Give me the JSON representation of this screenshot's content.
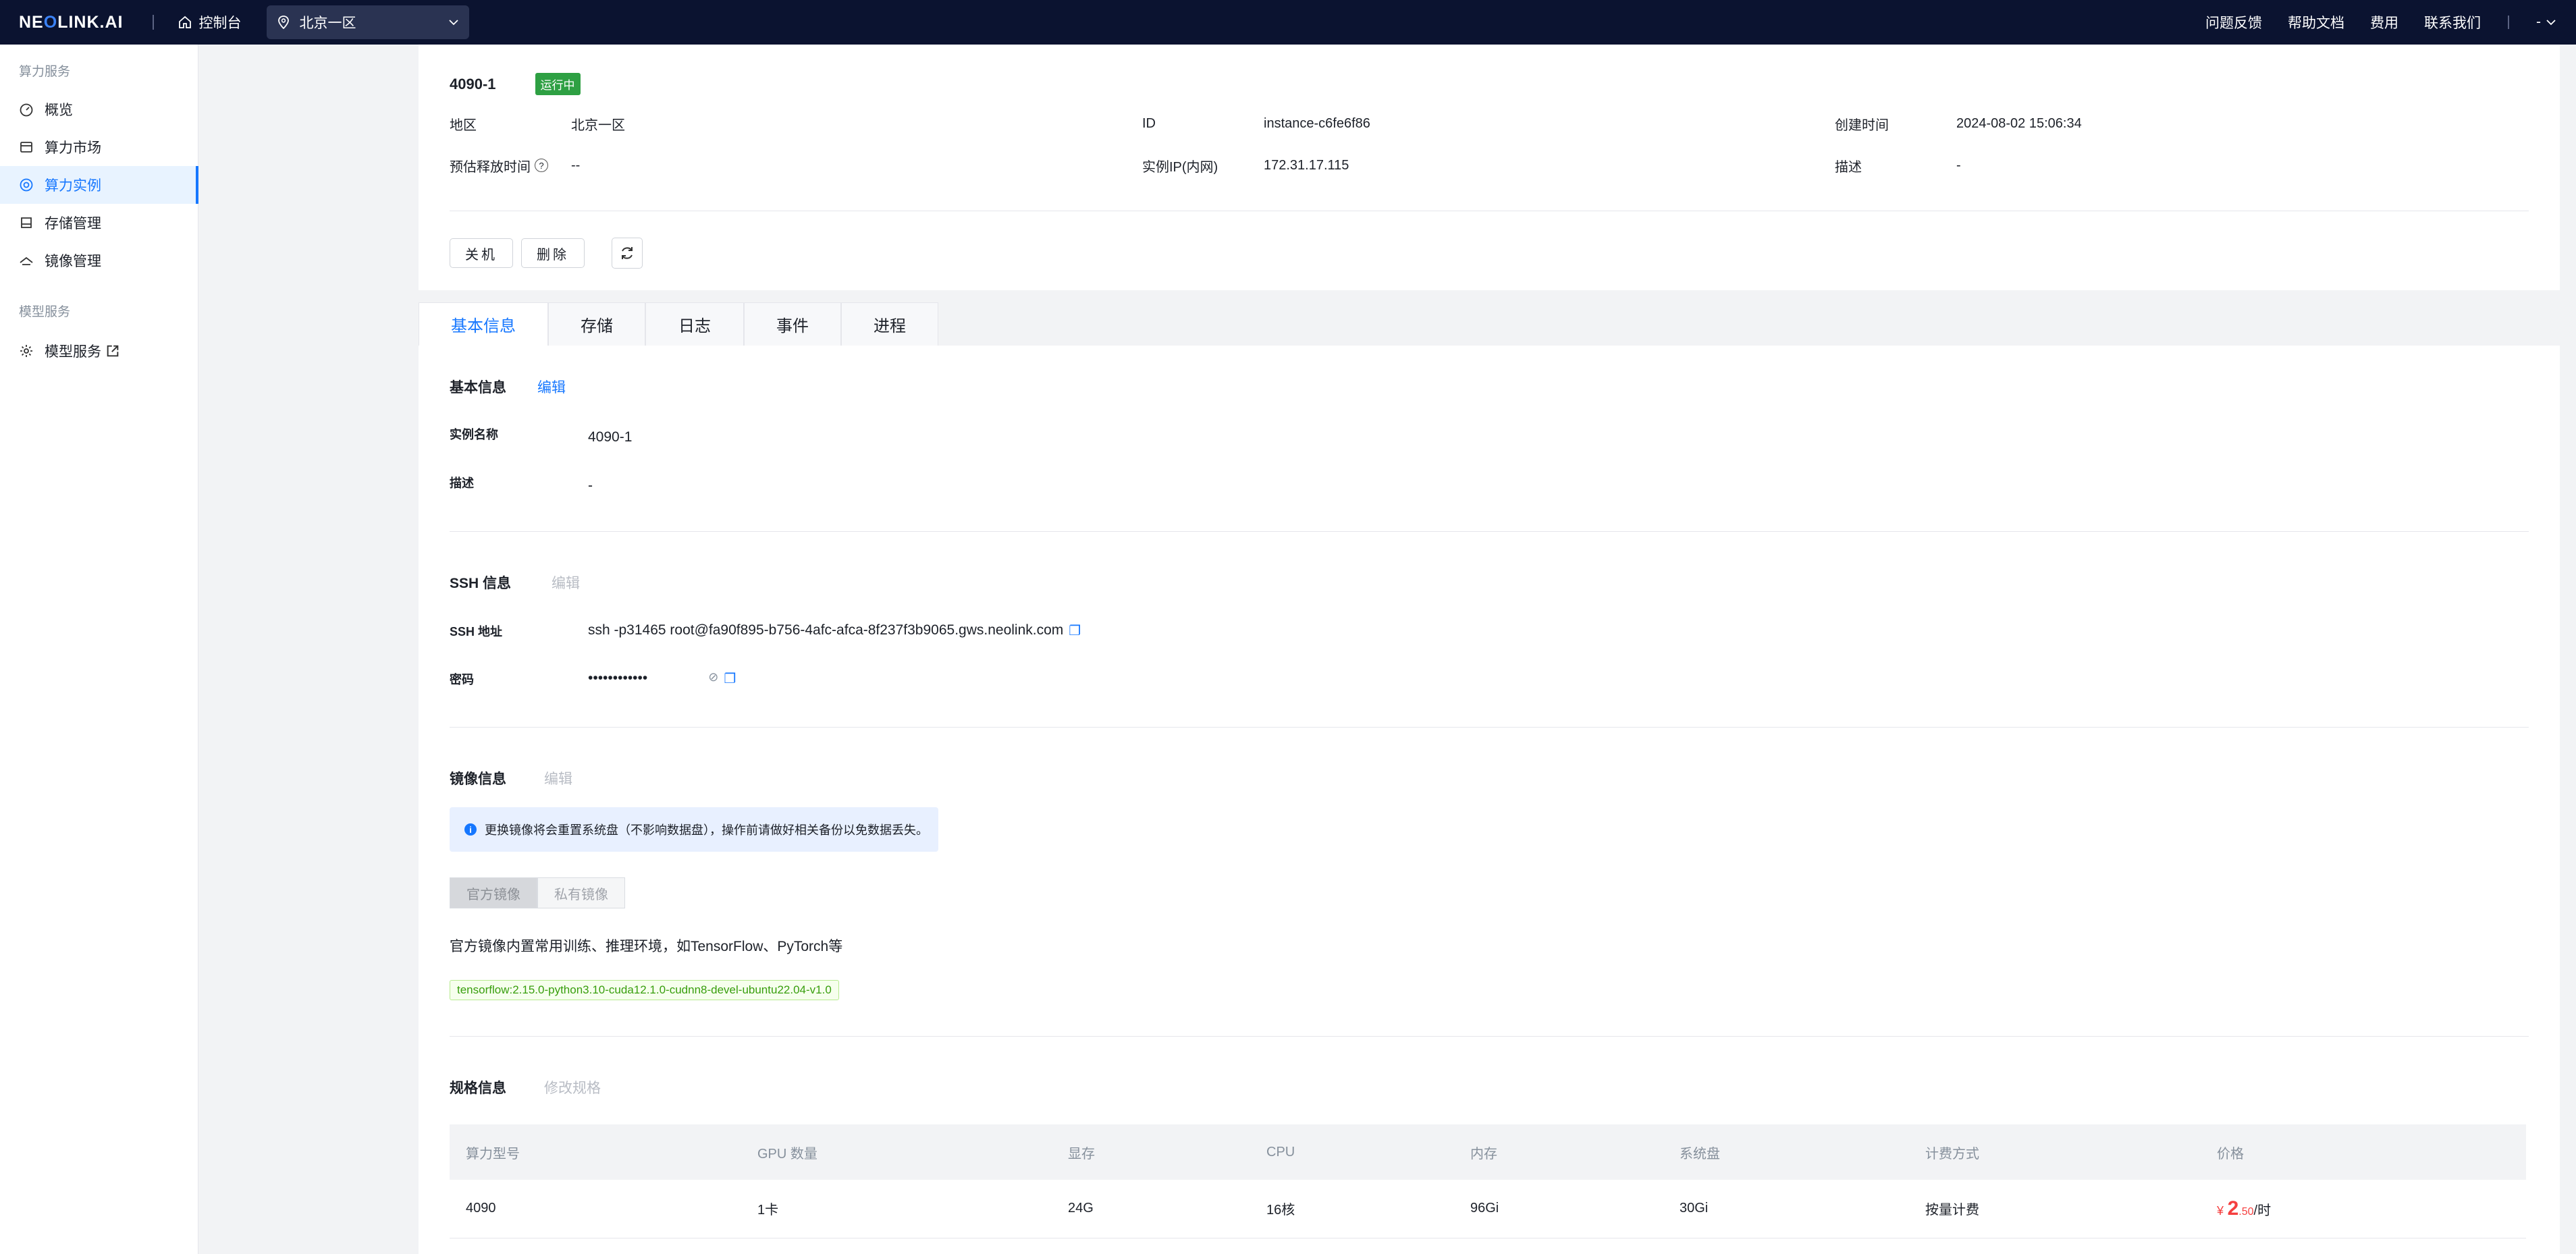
{
  "topbar": {
    "logo_part1": "NE",
    "logo_dot": "O",
    "logo_part2": "LINK.AI",
    "console_label": "控制台",
    "region_value": "北京一区",
    "links": [
      "问题反馈",
      "帮助文档",
      "费用",
      "联系我们"
    ],
    "user_label": "-"
  },
  "sidebar": {
    "group1": "算力服务",
    "items": [
      {
        "label": "概览",
        "icon": "dashboard-icon"
      },
      {
        "label": "算力市场",
        "icon": "store-icon"
      },
      {
        "label": "算力实例",
        "icon": "instance-icon"
      },
      {
        "label": "存储管理",
        "icon": "storage-icon"
      },
      {
        "label": "镜像管理",
        "icon": "image-icon"
      }
    ],
    "group2": "模型服务",
    "items2": [
      {
        "label": "模型服务",
        "icon": "gear-icon"
      }
    ]
  },
  "instance": {
    "name": "4090-1",
    "status": "运行中",
    "region_label": "地区",
    "region_value": "北京一区",
    "id_label": "ID",
    "id_value": "instance-c6fe6f86",
    "created_label": "创建时间",
    "created_value": "2024-08-02 15:06:34",
    "release_label": "预估释放时间",
    "release_value": "--",
    "ip_label": "实例IP(内网)",
    "ip_value": "172.31.17.115",
    "desc_label": "描述",
    "desc_value": "-"
  },
  "actions": {
    "shutdown": "关机",
    "delete": "删除"
  },
  "tabs": [
    "基本信息",
    "存储",
    "日志",
    "事件",
    "进程"
  ],
  "basic": {
    "title": "基本信息",
    "edit": "编辑",
    "name_label": "实例名称",
    "name_value": "4090-1",
    "desc_label": "描述",
    "desc_value": "-"
  },
  "ssh": {
    "title": "SSH 信息",
    "edit": "编辑",
    "addr_label": "SSH 地址",
    "addr_value": "ssh -p31465 root@fa90f895-b756-4afc-afca-8f237f3b9065.gws.neolink.com",
    "pwd_label": "密码",
    "pwd_value": "••••••••••••"
  },
  "image": {
    "title": "镜像信息",
    "edit": "编辑",
    "alert": "更换镜像将会重置系统盘（不影响数据盘），操作前请做好相关备份以免数据丢失。",
    "seg_official": "官方镜像",
    "seg_private": "私有镜像",
    "desc": "官方镜像内置常用训练、推理环境，如TensorFlow、PyTorch等",
    "tag": "tensorflow:2.15.0-python3.10-cuda12.1.0-cudnn8-devel-ubuntu22.04-v1.0"
  },
  "spec": {
    "title": "规格信息",
    "modify": "修改规格",
    "headers": [
      "算力型号",
      "GPU 数量",
      "显存",
      "CPU",
      "内存",
      "系统盘",
      "计费方式",
      "价格"
    ],
    "row": [
      "4090",
      "1卡",
      "24G",
      "16核",
      "96Gi",
      "30Gi",
      "按量计费"
    ],
    "price_currency": "¥",
    "price_int": "2",
    "price_dec": ".50",
    "price_unit": "/时"
  }
}
